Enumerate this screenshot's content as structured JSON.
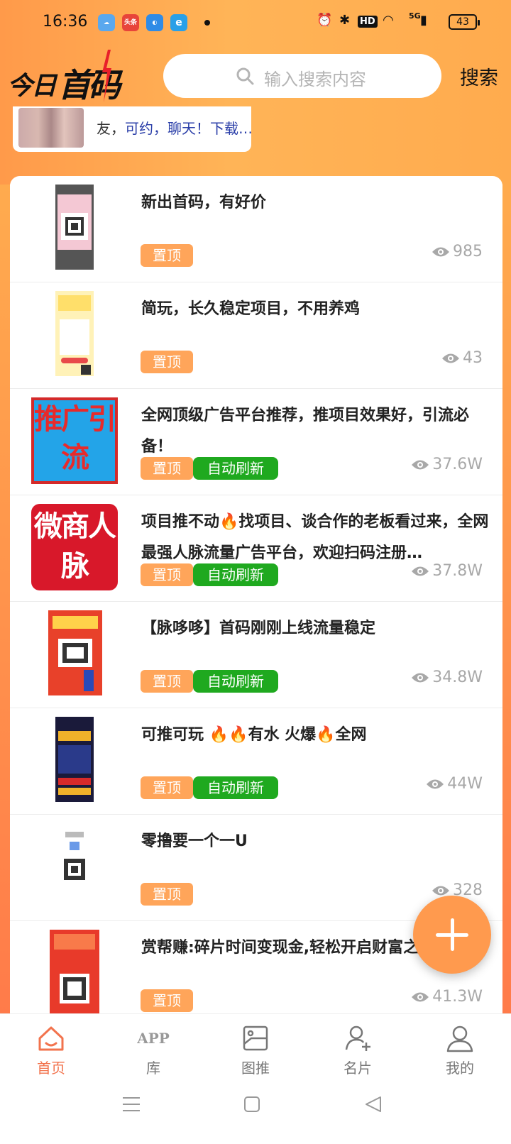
{
  "status_bar": {
    "time": "16:36",
    "apps": [
      "weather-app-icon",
      "toutiao-app-icon",
      "browser-app-icon",
      "ie-app-icon"
    ],
    "toutiao_label": "头条",
    "hd_label": "HD",
    "signal_label": "5G",
    "battery": "43"
  },
  "header": {
    "logo_text_1": "今日",
    "logo_text_2": "首码",
    "search_placeholder": "输入搜索内容",
    "search_button": "搜索"
  },
  "banner": {
    "text_prefix": "友，",
    "text_highlight": "可约，聊天！下载…"
  },
  "colors": {
    "accent": "#ffa55a",
    "active_tab": "#f2734d",
    "auto_refresh": "#1fa91f"
  },
  "tags": {
    "top": "置顶",
    "auto": "自动刷新"
  },
  "posts": [
    {
      "title": "新出首码，有好价",
      "views": "985",
      "auto": false
    },
    {
      "title": "简玩，长久稳定项目，不用养鸡",
      "views": "43",
      "auto": false
    },
    {
      "title": "全网顶级广告平台推荐，推项目效果好，引流必备！",
      "views": "37.6W",
      "auto": true,
      "thumb_text": "推广引流"
    },
    {
      "title": "项目推不动🔥找项目、谈合作的老板看过来，全网最强人脉流量广告平台，欢迎扫码注册…",
      "views": "37.8W",
      "auto": true,
      "thumb_text": "微商人脉"
    },
    {
      "title": "【脉哆哆】首码刚刚上线流量稳定",
      "views": "34.8W",
      "auto": true
    },
    {
      "title": "可推可玩 🔥🔥有水 火爆🔥全网",
      "views": "44W",
      "auto": true
    },
    {
      "title": "零撸要一个一U",
      "views": "328",
      "auto": false
    },
    {
      "title": "赏帮赚:碎片时间变现金,轻松开启财富之旅》",
      "views": "41.3W",
      "auto": false
    }
  ],
  "tabbar": [
    {
      "label": "首页",
      "icon": "home-icon",
      "active": true
    },
    {
      "label": "库",
      "icon": "app-library-icon",
      "active": false,
      "icon_text": "APP"
    },
    {
      "label": "图推",
      "icon": "image-post-icon",
      "active": false
    },
    {
      "label": "名片",
      "icon": "add-contact-icon",
      "active": false
    },
    {
      "label": "我的",
      "icon": "profile-icon",
      "active": false
    }
  ]
}
